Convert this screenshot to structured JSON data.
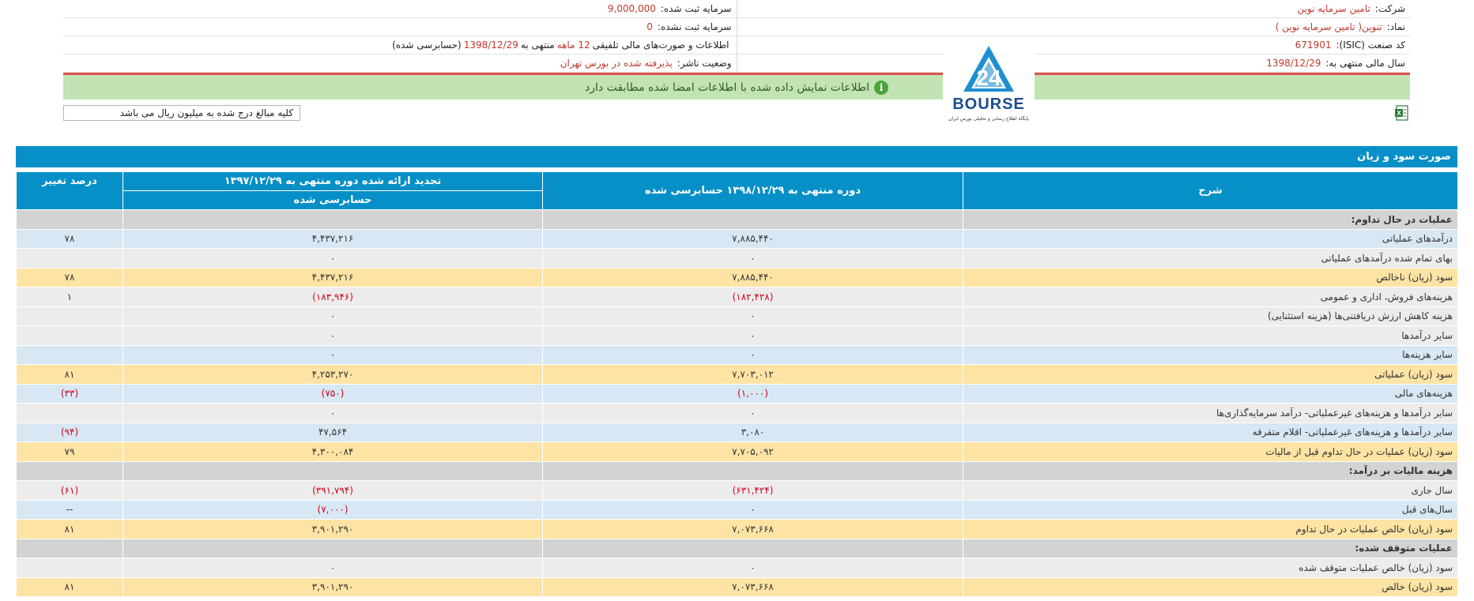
{
  "company": {
    "company_label": "شرکت:",
    "company_value": "تامین سرمایه نوین",
    "registered_capital_label": "سرمایه ثبت شده:",
    "registered_capital_value": "9,000,000",
    "symbol_label": "نماد:",
    "symbol_value": "تنوین( تامین سرمایه نوین )",
    "unregistered_capital_label": "سرمایه ثبت نشده:",
    "unregistered_capital_value": "0",
    "isic_label": "کد صنعت (ISIC):",
    "isic_value": "671901",
    "report_text_1": "اطلاعات و صورت‌های مالی تلفیقی",
    "report_period": "12 ماهه",
    "report_text_2": "منتهی به",
    "report_date": "1398/12/29",
    "report_status": "(حسابرسی شده)",
    "fiscal_year_label": "سال مالی منتهی به:",
    "fiscal_year_value": "1398/12/29",
    "publisher_status_label": "وضعیت ناشر:",
    "publisher_status_value": "پذیرفته شده در بورس تهران"
  },
  "notice": {
    "text": "اطلاعات نمایش داده شده با اطلاعات امضا شده مطابقت دارد",
    "icon": "info-icon",
    "color": "#c2e3b4"
  },
  "logo": {
    "text": "BOURSE",
    "subtitle": "پایگاه اطلاع رسانی و تحلیلی بورس ایران",
    "mark": "24"
  },
  "units_note": "کلیه مبالغ درج شده به میلیون ریال می باشد",
  "section_title": "صورت سود و زیان",
  "colors": {
    "header_blue": "#0690c7",
    "sum_row": "#fde3a4",
    "alt_row": "#d7e7f4",
    "negative": "#d0021b"
  },
  "table": {
    "headers": {
      "description": "شرح",
      "current": "دوره منتهی به ۱۳۹۸/۱۲/۲۹ حسابرسی شده",
      "previous": "تجدید ارائه شده دوره منتهی به ۱۳۹۷/۱۲/۲۹",
      "previous_sub": "حسابرسی شده",
      "change": "درصد تغییر"
    },
    "rows": [
      {
        "type": "section",
        "desc": "عملیات در حال تداوم:",
        "cur": "",
        "prev": "",
        "chg": ""
      },
      {
        "type": "alt",
        "desc": "درآمدهای عملیاتی",
        "cur": "۷,۸۸۵,۴۴۰",
        "prev": "۴,۴۳۷,۲۱۶",
        "chg": "۷۸"
      },
      {
        "type": "normal",
        "desc": "بهای تمام شده درآمدهای عملیاتی",
        "cur": "۰",
        "prev": "۰",
        "chg": ""
      },
      {
        "type": "sum",
        "desc": "سود (زیان) ناخالص",
        "cur": "۷,۸۸۵,۴۴۰",
        "prev": "۴,۴۳۷,۲۱۶",
        "chg": "۷۸"
      },
      {
        "type": "normal",
        "desc": "هزینه‌های فروش، اداری و عمومی",
        "cur": "(۱۸۲,۴۲۸)",
        "prev": "(۱۸۳,۹۴۶)",
        "chg": "۱"
      },
      {
        "type": "normal",
        "desc": "هزینه کاهش ارزش دریافتنی‌ها (هزینه استثنایی)",
        "cur": "۰",
        "prev": "۰",
        "chg": ""
      },
      {
        "type": "normal",
        "desc": "سایر درآمدها",
        "cur": "۰",
        "prev": "۰",
        "chg": ""
      },
      {
        "type": "alt",
        "desc": "سایر هزینه‌ها",
        "cur": "۰",
        "prev": "۰",
        "chg": ""
      },
      {
        "type": "sum",
        "desc": "سود (زیان) عملیاتی",
        "cur": "۷,۷۰۳,۰۱۲",
        "prev": "۴,۲۵۳,۲۷۰",
        "chg": "۸۱"
      },
      {
        "type": "alt",
        "desc": "هزینه‌های مالی",
        "cur": "(۱,۰۰۰)",
        "prev": "(۷۵۰)",
        "chg": "(۳۳)"
      },
      {
        "type": "normal",
        "desc": "سایر درآمدها و هزینه‌های غیرعملیاتی- درآمد سرمایه‌گذاری‌ها",
        "cur": "۰",
        "prev": "۰",
        "chg": ""
      },
      {
        "type": "alt",
        "desc": "سایر درآمدها و هزینه‌های غیرعملیاتی- اقلام متفرقه",
        "cur": "۳,۰۸۰",
        "prev": "۴۷,۵۶۴",
        "chg": "(۹۴)"
      },
      {
        "type": "sum",
        "desc": "سود (زیان) عملیات در حال تداوم قبل از مالیات",
        "cur": "۷,۷۰۵,۰۹۲",
        "prev": "۴,۳۰۰,۰۸۴",
        "chg": "۷۹"
      },
      {
        "type": "section",
        "desc": "هزینه مالیات بر درآمد:",
        "cur": "",
        "prev": "",
        "chg": ""
      },
      {
        "type": "normal",
        "desc": "سال جاری",
        "cur": "(۶۳۱,۴۲۴)",
        "prev": "(۳۹۱,۷۹۴)",
        "chg": "(۶۱)"
      },
      {
        "type": "alt",
        "desc": "سال‌های قبل",
        "cur": "۰",
        "prev": "(۷,۰۰۰)",
        "chg": "--"
      },
      {
        "type": "sum",
        "desc": "سود (زیان) خالص عملیات در حال تداوم",
        "cur": "۷,۰۷۳,۶۶۸",
        "prev": "۳,۹۰۱,۲۹۰",
        "chg": "۸۱"
      },
      {
        "type": "section",
        "desc": "عملیات متوقف شده:",
        "cur": "",
        "prev": "",
        "chg": ""
      },
      {
        "type": "normal",
        "desc": "سود (زیان) خالص عملیات متوقف شده",
        "cur": "۰",
        "prev": "۰",
        "chg": ""
      },
      {
        "type": "sum",
        "desc": "سود (زیان) خالص",
        "cur": "۷,۰۷۳,۶۶۸",
        "prev": "۳,۹۰۱,۲۹۰",
        "chg": "۸۱"
      }
    ]
  }
}
